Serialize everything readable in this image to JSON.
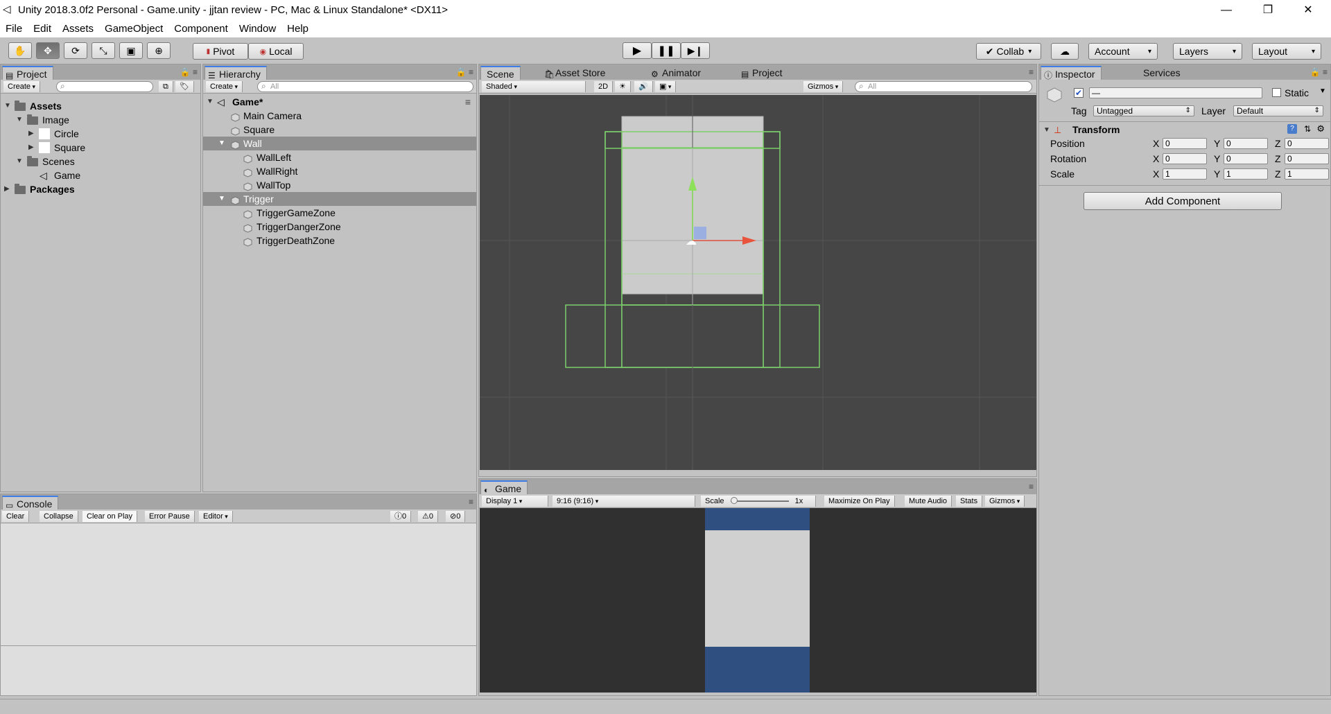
{
  "window": {
    "title": "Unity 2018.3.0f2 Personal - Game.unity - jjtan review - PC, Mac & Linux Standalone* <DX11>",
    "minimize_icon": "minimize-icon",
    "restore_icon": "restore-icon",
    "close_icon": "close-icon"
  },
  "menu": [
    "File",
    "Edit",
    "Assets",
    "GameObject",
    "Component",
    "Window",
    "Help"
  ],
  "toolbar": {
    "tools": [
      "hand-icon",
      "move-icon",
      "rotate-icon",
      "scale-icon",
      "rect-icon",
      "transform-icon"
    ],
    "pivot_label": "Pivot",
    "local_label": "Local",
    "collab_label": "Collab",
    "account_label": "Account",
    "layers_label": "Layers",
    "layout_label": "Layout"
  },
  "project": {
    "tab": "Project",
    "create": "Create",
    "tree": {
      "assets": "Assets",
      "image": "Image",
      "circle": "Circle",
      "square": "Square",
      "scenes": "Scenes",
      "game": "Game",
      "packages": "Packages"
    }
  },
  "hierarchy": {
    "tab": "Hierarchy",
    "create": "Create",
    "search_placeholder": "All",
    "scene_name": "Game*",
    "items": {
      "main_camera": "Main Camera",
      "square": "Square",
      "wall": "Wall",
      "wall_left": "WallLeft",
      "wall_right": "WallRight",
      "wall_top": "WallTop",
      "trigger": "Trigger",
      "trigger_game": "TriggerGameZone",
      "trigger_danger": "TriggerDangerZone",
      "trigger_death": "TriggerDeathZone"
    }
  },
  "scene": {
    "tabs": {
      "scene": "Scene",
      "asset_store": "Asset Store",
      "animator": "Animator",
      "project": "Project"
    },
    "shading": "Shaded",
    "mode_2d": "2D",
    "gizmos": "Gizmos",
    "search_placeholder": "All"
  },
  "game": {
    "tab": "Game",
    "display": "Display 1",
    "aspect": "9:16 (9:16)",
    "scale_label": "Scale",
    "scale_value": "1x",
    "maximize": "Maximize On Play",
    "mute": "Mute Audio",
    "stats": "Stats",
    "gizmos": "Gizmos",
    "colors": {
      "blue": "#2f4f80",
      "light": "#d0d0d0",
      "bg": "#303030"
    }
  },
  "console": {
    "tab": "Console",
    "clear": "Clear",
    "collapse": "Collapse",
    "clear_on_play": "Clear on Play",
    "error_pause": "Error Pause",
    "editor": "Editor",
    "info_count": "0",
    "warn_count": "0",
    "error_count": "0"
  },
  "inspector": {
    "tabs": {
      "inspector": "Inspector",
      "services": "Services"
    },
    "name_value": "—",
    "static_label": "Static",
    "tag_label": "Tag",
    "tag_value": "Untagged",
    "layer_label": "Layer",
    "layer_value": "Default",
    "transform_title": "Transform",
    "position_label": "Position",
    "rotation_label": "Rotation",
    "scale_label": "Scale",
    "x": "X",
    "y": "Y",
    "z": "Z",
    "position": [
      "0",
      "0",
      "0"
    ],
    "rotation": [
      "0",
      "0",
      "0"
    ],
    "scale": [
      "1",
      "1",
      "1"
    ],
    "add_component": "Add Component"
  }
}
